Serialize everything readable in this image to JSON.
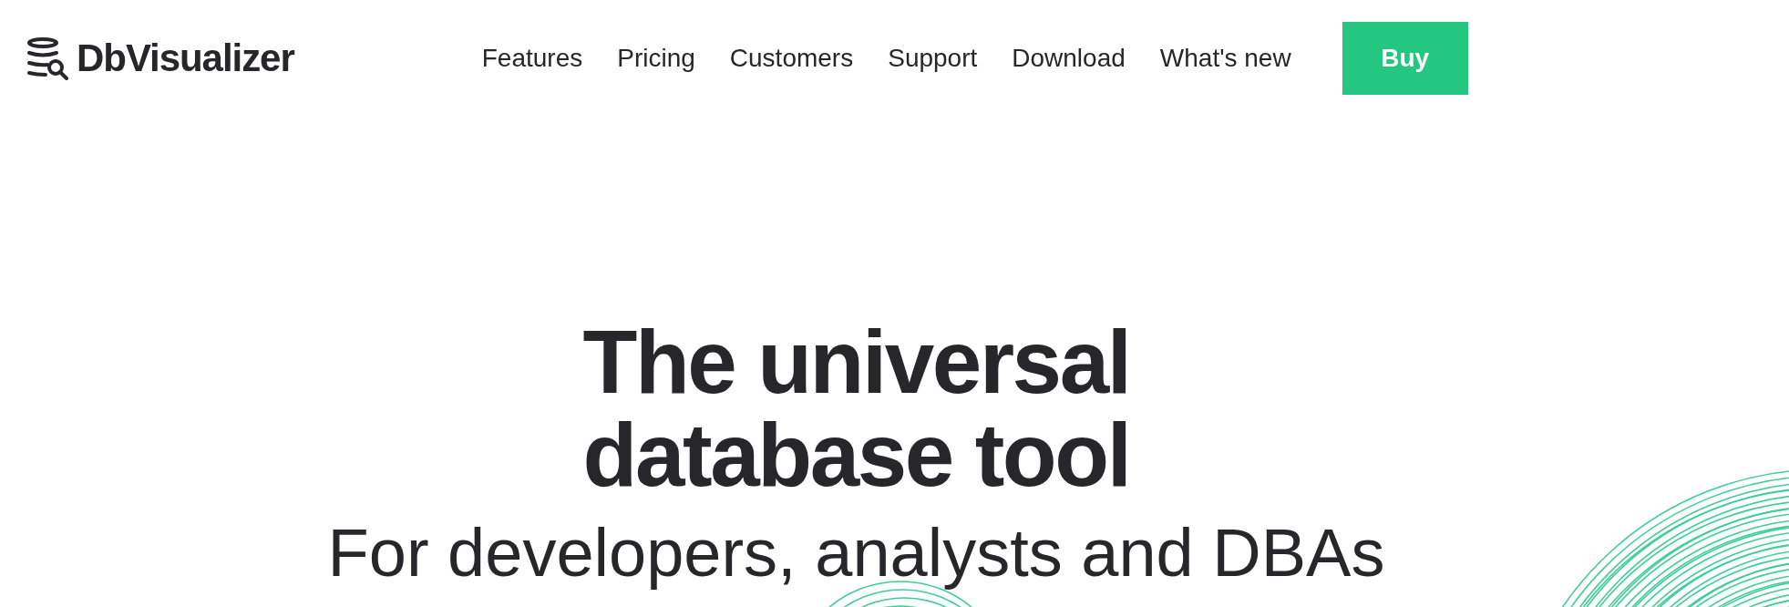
{
  "header": {
    "logo": "DbVisualizer",
    "nav": [
      "Features",
      "Pricing",
      "Customers",
      "Support",
      "Download",
      "What's new"
    ],
    "cta": "Buy"
  },
  "hero": {
    "title_lines": [
      "The universal",
      "database tool"
    ],
    "subtitle": "For developers, analysts and DBAs"
  }
}
